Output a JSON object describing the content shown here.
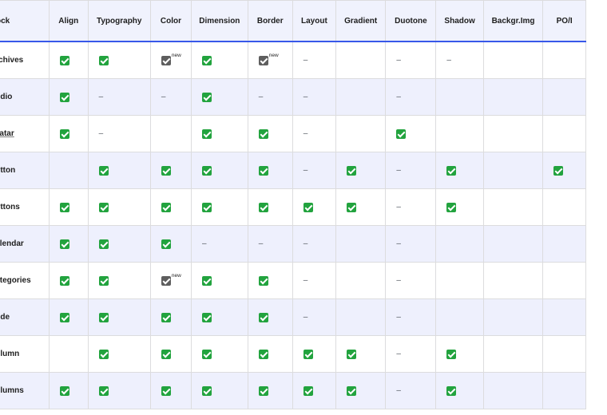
{
  "columns": [
    "Block",
    "Align",
    "Typography",
    "Color",
    "Dimension",
    "Border",
    "Layout",
    "Gradient",
    "Duotone",
    "Shadow",
    "Backgr.Img",
    "PO/I"
  ],
  "rows": [
    {
      "name": "Archives",
      "cells": [
        "check",
        "check",
        "check-new",
        "check",
        "check-new",
        "dash",
        "",
        "dash",
        "dash",
        "",
        ""
      ]
    },
    {
      "name": "Audio",
      "cells": [
        "check",
        "dash",
        "dash",
        "check",
        "dash",
        "dash",
        "",
        "dash",
        "",
        "",
        ""
      ]
    },
    {
      "name": "Avatar",
      "cells": [
        "check",
        "dash",
        "",
        "check",
        "check",
        "dash",
        "",
        "check",
        "",
        "",
        ""
      ]
    },
    {
      "name": "Button",
      "cells": [
        "",
        "check",
        "check",
        "check",
        "check",
        "dash",
        "check",
        "dash",
        "check",
        "",
        "check"
      ]
    },
    {
      "name": "Buttons",
      "cells": [
        "check",
        "check",
        "check",
        "check",
        "check",
        "check",
        "check",
        "dash",
        "check",
        "",
        ""
      ]
    },
    {
      "name": "Calendar",
      "cells": [
        "check",
        "check",
        "check",
        "dash",
        "dash",
        "dash",
        "",
        "dash",
        "",
        "",
        ""
      ]
    },
    {
      "name": "Categories",
      "cells": [
        "check",
        "check",
        "check-new",
        "check",
        "check",
        "dash",
        "",
        "dash",
        "",
        "",
        ""
      ]
    },
    {
      "name": "Code",
      "cells": [
        "check",
        "check",
        "check",
        "check",
        "check",
        "dash",
        "",
        "dash",
        "",
        "",
        ""
      ]
    },
    {
      "name": "Column",
      "cells": [
        "",
        "check",
        "check",
        "check",
        "check",
        "check",
        "check",
        "dash",
        "check",
        "",
        ""
      ]
    },
    {
      "name": "Columns",
      "cells": [
        "check",
        "check",
        "check",
        "check",
        "check",
        "check",
        "check",
        "dash",
        "check",
        "",
        ""
      ]
    }
  ],
  "symbols": {
    "dash": "–",
    "new": "new"
  },
  "icons": {
    "check": "check-icon",
    "check_gray": "check-gray-icon"
  },
  "colors": {
    "header_bg": "#f0f2fd",
    "accent": "#3858e9",
    "alt_row": "#eef0fd",
    "check_green": "#22a33e",
    "check_gray": "#5e5e5e"
  }
}
